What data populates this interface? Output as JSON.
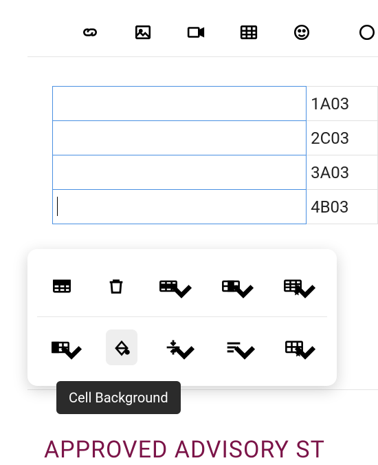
{
  "toolbar": {
    "items": [
      "link",
      "image",
      "video",
      "table",
      "emoji",
      "more"
    ]
  },
  "table": {
    "rows": [
      {
        "c0": "",
        "c1": "1A03"
      },
      {
        "c0": "",
        "c1": "2C03"
      },
      {
        "c0": "",
        "c1": "3A03"
      },
      {
        "c0": "",
        "c1": "4B03"
      }
    ],
    "cursor_row": 3
  },
  "popup": {
    "row1": [
      "table-header",
      "delete",
      "insert-row",
      "insert-column",
      "table-style"
    ],
    "row2": [
      "cell-split",
      "cell-background",
      "vertical-align",
      "horizontal-align",
      "cell-style"
    ]
  },
  "tooltip": "Cell Background",
  "heading": "APPROVED ADVISORY ST"
}
